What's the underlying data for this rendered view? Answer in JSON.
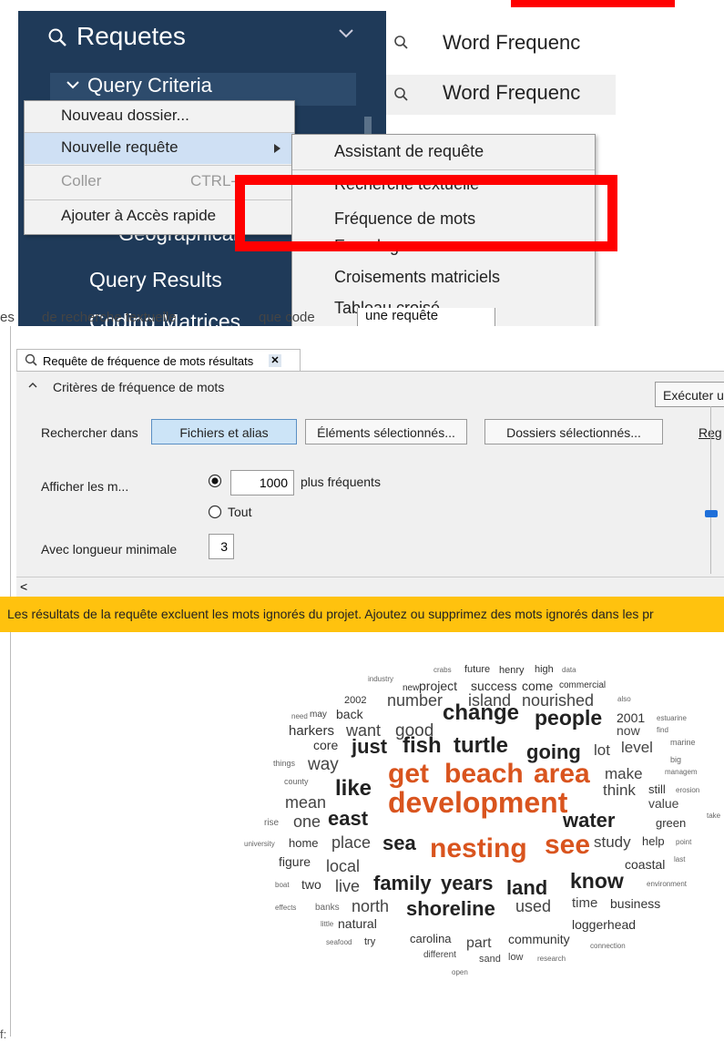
{
  "nav": {
    "requetes": "Requetes",
    "query_criteria": "Query Criteria",
    "geographical": "Geographical",
    "query_results": "Query Results",
    "coding_matrices": "Coding Matrices"
  },
  "right_list": [
    {
      "label": "Word Frequenc"
    },
    {
      "label": "Word Frequenc"
    }
  ],
  "context_menu": {
    "items": [
      {
        "label": "Nouveau dossier..."
      },
      {
        "label": "Nouvelle requête"
      },
      {
        "label": "Coller",
        "shortcut": "CTRL-"
      },
      {
        "label": "Ajouter à Accès rapide"
      }
    ]
  },
  "submenu": {
    "items": [
      {
        "label": "Assistant de requête"
      },
      {
        "label": "Recherche textuelle"
      },
      {
        "label": "Fréquence de mots"
      },
      {
        "label": "Encodage"
      },
      {
        "label": "Croisements matriciels"
      },
      {
        "label": "Tableau croisé"
      }
    ]
  },
  "tabstrip": {
    "t1": "es",
    "t2": "de recherche textuelle",
    "t3": "que code",
    "t4": "une requête"
  },
  "panel": {
    "tab_title": "Requête de fréquence de mots résultats",
    "section_title": "Critères de fréquence de mots",
    "run_button": "Exécuter u",
    "search_in_label": "Rechercher dans",
    "btn_files": "Fichiers et alias",
    "btn_selected": "Éléments sélectionnés...",
    "btn_folders": "Dossiers sélectionnés...",
    "reg_link": "Reg",
    "show_label": "Afficher les m...",
    "top_value": "1000",
    "top_suffix": "plus fréquents",
    "all_option": "Tout",
    "minlen_label": "Avec longueur minimale",
    "minlen_value": "3",
    "scroll_left": "<"
  },
  "warning": "Les résultats de la requête excluent les mots ignorés du projet. Ajoutez ou supprimez des mots ignorés dans les pr",
  "footer_text": "f:",
  "colors": {
    "nav_bg": "#1f3a59",
    "orange": "#d9541e",
    "warning_bg": "#ffc20e",
    "highlight": "#ff0000"
  }
}
